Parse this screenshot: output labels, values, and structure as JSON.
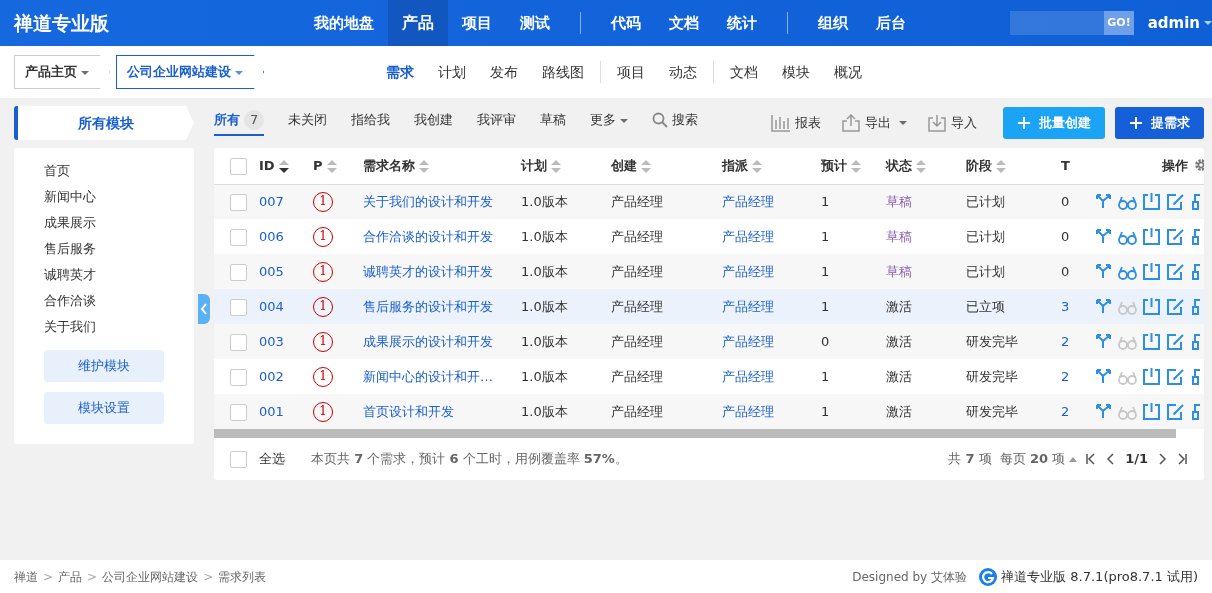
{
  "brand": "禅道专业版",
  "main_nav": [
    [
      {
        "label": "我的地盘",
        "selected": false
      },
      {
        "label": "产品",
        "selected": true
      },
      {
        "label": "项目",
        "selected": false
      },
      {
        "label": "测试",
        "selected": false
      }
    ],
    [
      {
        "label": "代码",
        "selected": false
      },
      {
        "label": "文档",
        "selected": false
      },
      {
        "label": "统计",
        "selected": false
      }
    ],
    [
      {
        "label": "组织",
        "selected": false
      },
      {
        "label": "后台",
        "selected": false
      }
    ]
  ],
  "search": {
    "button": "GO!"
  },
  "user": "admin",
  "breadcrumb_menus": [
    {
      "label": "产品主页",
      "selected": false
    },
    {
      "label": "公司企业网站建设",
      "selected": true
    }
  ],
  "sub_nav": [
    [
      {
        "label": "需求",
        "selected": true
      },
      {
        "label": "计划",
        "selected": false
      },
      {
        "label": "发布",
        "selected": false
      },
      {
        "label": "路线图",
        "selected": false
      }
    ],
    [
      {
        "label": "项目",
        "selected": false
      },
      {
        "label": "动态",
        "selected": false
      }
    ],
    [
      {
        "label": "文档",
        "selected": false
      },
      {
        "label": "模块",
        "selected": false
      },
      {
        "label": "概况",
        "selected": false
      }
    ]
  ],
  "sidebar": {
    "title": "所有模块",
    "items": [
      "首页",
      "新闻中心",
      "成果展示",
      "售后服务",
      "诚聘英才",
      "合作洽谈",
      "关于我们"
    ],
    "buttons": [
      "维护模块",
      "模块设置"
    ]
  },
  "filters": [
    {
      "label": "所有",
      "count": "7",
      "selected": true,
      "kind": "tab"
    },
    {
      "label": "未关闭",
      "selected": false,
      "kind": "tab"
    },
    {
      "label": "指给我",
      "selected": false,
      "kind": "tab"
    },
    {
      "label": "我创建",
      "selected": false,
      "kind": "tab"
    },
    {
      "label": "我评审",
      "selected": false,
      "kind": "tab"
    },
    {
      "label": "草稿",
      "selected": false,
      "kind": "tab"
    },
    {
      "label": "更多",
      "selected": false,
      "kind": "dropdown"
    },
    {
      "label": "搜索",
      "selected": false,
      "kind": "search"
    }
  ],
  "toolbar": [
    {
      "label": "报表",
      "kind": "report"
    },
    {
      "label": "导出",
      "kind": "export"
    },
    {
      "label": "导入",
      "kind": "import"
    }
  ],
  "actions": [
    {
      "label": "批量创建",
      "kind": "secondary"
    },
    {
      "label": "提需求",
      "kind": "primary"
    }
  ],
  "table": {
    "header_checked": false,
    "columns": [
      {
        "label": "ID",
        "sorted": true
      },
      {
        "label": "P",
        "sorted": false
      },
      {
        "label": "需求名称",
        "sorted": false
      },
      {
        "label": "计划",
        "sorted": false
      },
      {
        "label": "创建",
        "sorted": false
      },
      {
        "label": "指派",
        "sorted": false
      },
      {
        "label": "预计",
        "sorted": false
      },
      {
        "label": "状态",
        "sorted": false
      },
      {
        "label": "阶段",
        "sorted": false
      },
      {
        "label": "T"
      },
      {
        "label": "操作"
      }
    ],
    "rows": [
      {
        "id": "007",
        "pri": "1",
        "title": "关于我们的设计和开发",
        "plan": "1.0版本",
        "creator": "产品经理",
        "assigned": "产品经理",
        "estimate": "1",
        "status": {
          "text": "草稿",
          "color": "#8b5fb0"
        },
        "stage": "已计划",
        "tasks": "0",
        "tasks_link": false,
        "review_disabled": false,
        "highlighted": false,
        "checked": false
      },
      {
        "id": "006",
        "pri": "1",
        "title": "合作洽谈的设计和开发",
        "plan": "1.0版本",
        "creator": "产品经理",
        "assigned": "产品经理",
        "estimate": "1",
        "status": {
          "text": "草稿",
          "color": "#8b5fb0"
        },
        "stage": "已计划",
        "tasks": "0",
        "tasks_link": false,
        "review_disabled": false,
        "highlighted": false,
        "checked": false
      },
      {
        "id": "005",
        "pri": "1",
        "title": "诚聘英才的设计和开发",
        "plan": "1.0版本",
        "creator": "产品经理",
        "assigned": "产品经理",
        "estimate": "1",
        "status": {
          "text": "草稿",
          "color": "#8b5fb0"
        },
        "stage": "已计划",
        "tasks": "0",
        "tasks_link": false,
        "review_disabled": false,
        "highlighted": false,
        "checked": false
      },
      {
        "id": "004",
        "pri": "1",
        "title": "售后服务的设计和开发",
        "plan": "1.0版本",
        "creator": "产品经理",
        "assigned": "产品经理",
        "estimate": "1",
        "status": {
          "text": "激活"
        },
        "stage": "已立项",
        "tasks": "3",
        "tasks_link": true,
        "review_disabled": true,
        "highlighted": true,
        "checked": false
      },
      {
        "id": "003",
        "pri": "1",
        "title": "成果展示的设计和开发",
        "plan": "1.0版本",
        "creator": "产品经理",
        "assigned": "产品经理",
        "estimate": "0",
        "status": {
          "text": "激活"
        },
        "stage": "研发完毕",
        "tasks": "2",
        "tasks_link": true,
        "review_disabled": true,
        "highlighted": false,
        "checked": false
      },
      {
        "id": "002",
        "pri": "1",
        "title": "新闻中心的设计和开…",
        "plan": "1.0版本",
        "creator": "产品经理",
        "assigned": "产品经理",
        "estimate": "1",
        "status": {
          "text": "激活"
        },
        "stage": "研发完毕",
        "tasks": "2",
        "tasks_link": true,
        "review_disabled": true,
        "highlighted": false,
        "checked": false
      },
      {
        "id": "001",
        "pri": "1",
        "title": "首页设计和开发",
        "plan": "1.0版本",
        "creator": "产品经理",
        "assigned": "产品经理",
        "estimate": "1",
        "status": {
          "text": "激活"
        },
        "stage": "研发完毕",
        "tasks": "2",
        "tasks_link": true,
        "review_disabled": true,
        "highlighted": false,
        "checked": false
      }
    ]
  },
  "table_footer": {
    "select_all": "全选",
    "select_all_checked": false,
    "summary": "本页共 **7** 个需求，预计 **6** 个工时，用例覆盖率 **57%**。",
    "total": "共 **7** 项",
    "per_page": "每页 **20** 项",
    "page": "1/1"
  },
  "footer": {
    "breadcrumb": [
      {
        "label": "禅道"
      },
      {
        "separator": ">",
        "label": "产品"
      },
      {
        "separator": ">",
        "label": "公司企业网站建设"
      },
      {
        "separator": ">",
        "label": "需求列表"
      }
    ],
    "designed_by": "Designed by",
    "designer": "艾体验",
    "version": "禅道专业版 8.7.1(pro8.7.1 试用)"
  }
}
